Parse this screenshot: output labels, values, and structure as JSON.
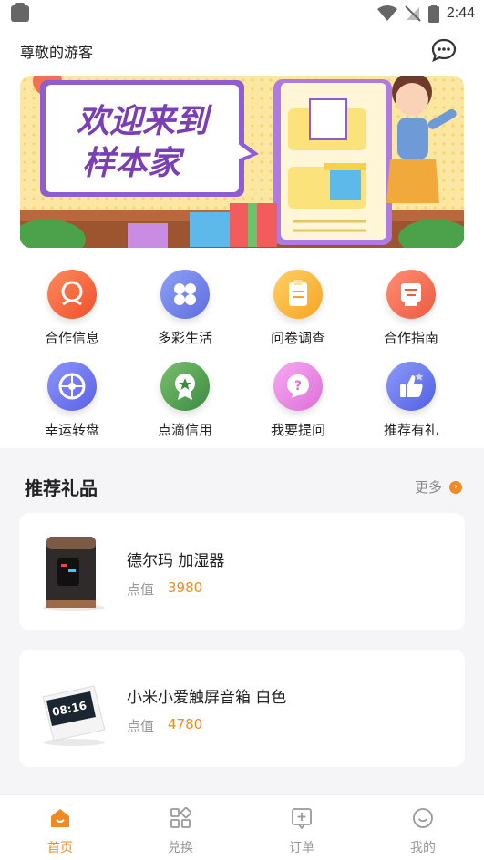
{
  "status_bar": {
    "time": "2:44"
  },
  "header": {
    "greeting": "尊敬的游客"
  },
  "banner": {
    "line1": "欢迎来到",
    "line2": "样本家"
  },
  "grid": [
    {
      "label": "合作信息",
      "icon": "location-person-icon",
      "color": "#f26a3d"
    },
    {
      "label": "多彩生活",
      "icon": "petals-icon",
      "color": "#6f7fe8"
    },
    {
      "label": "问卷调查",
      "icon": "clipboard-icon",
      "color": "#f9b43a"
    },
    {
      "label": "合作指南",
      "icon": "guide-book-icon",
      "color": "#f36b56"
    },
    {
      "label": "幸运转盘",
      "icon": "lucky-wheel-icon",
      "color": "#6a70ee"
    },
    {
      "label": "点滴信用",
      "icon": "medal-icon",
      "color": "#4e9a52"
    },
    {
      "label": "我要提问",
      "icon": "question-icon",
      "color": "#e67fe0"
    },
    {
      "label": "推荐有礼",
      "icon": "thumbs-up-icon",
      "color": "#5b6ae8"
    }
  ],
  "recommend": {
    "title": "推荐礼品",
    "more": "更多",
    "items": [
      {
        "name": "德尔玛 加湿器",
        "points_label": "点值",
        "points": "3980"
      },
      {
        "name": "小米小爱触屏音箱 白色",
        "points_label": "点值",
        "points": "4780"
      }
    ]
  },
  "clock_display": "08:16",
  "tabs": [
    {
      "label": "首页",
      "icon": "home-icon",
      "active": true
    },
    {
      "label": "兑换",
      "icon": "exchange-icon",
      "active": false
    },
    {
      "label": "订单",
      "icon": "order-icon",
      "active": false
    },
    {
      "label": "我的",
      "icon": "profile-icon",
      "active": false
    }
  ],
  "colors": {
    "accent": "#f08a24",
    "banner_text": "#7b3fb5"
  }
}
